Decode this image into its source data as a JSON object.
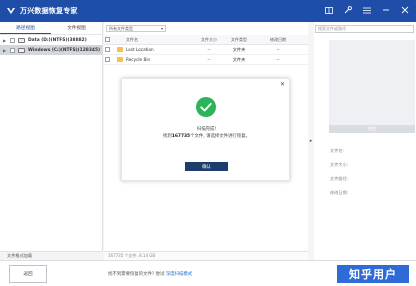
{
  "app": {
    "title": "万兴数据恢复专家"
  },
  "left_panel": {
    "tabs": [
      {
        "label": "路径视图"
      },
      {
        "label": "文件视图"
      }
    ],
    "tree": [
      {
        "label": "Data (D:)(NTFS)(38882)"
      },
      {
        "label": "Windows (C:)(NTFS)(128345)"
      }
    ],
    "footer": "文件格式加载"
  },
  "main": {
    "filter_value": "所有文件类型",
    "columns": {
      "name": "文件名",
      "size": "文件大小",
      "type": "文件类型",
      "modified": "修改日期"
    },
    "rows": [
      {
        "name": "Lost Location",
        "size": "--",
        "type": "文件夹",
        "modified": "--"
      },
      {
        "name": "Recycle Bin",
        "size": "--",
        "type": "文件夹",
        "modified": "--"
      }
    ],
    "footer": "167735 个文件, 8.14 GB"
  },
  "right_panel": {
    "search_placeholder": "搜索文件或路径",
    "preview_label": "预览",
    "meta": [
      "文件名:",
      "文件大小:",
      "文件路径:",
      "修改日期:"
    ]
  },
  "modal": {
    "title": "扫描完成!",
    "msg_prefix": "找到",
    "msg_count": "167735",
    "msg_suffix": "个文件, 请选择文件进行恢复。",
    "ok_label": "确认"
  },
  "bottom_bar": {
    "back_label": "返回",
    "hint_text": "找不到需要恢复的文件?  尝试",
    "hint_link": "深度扫描模式",
    "recover_label": "知乎用户"
  },
  "colors": {
    "brand": "#1f4ea8",
    "accent": "#2e6bd6",
    "success": "#2fb35a",
    "dialog_button": "#1f3d6b"
  }
}
